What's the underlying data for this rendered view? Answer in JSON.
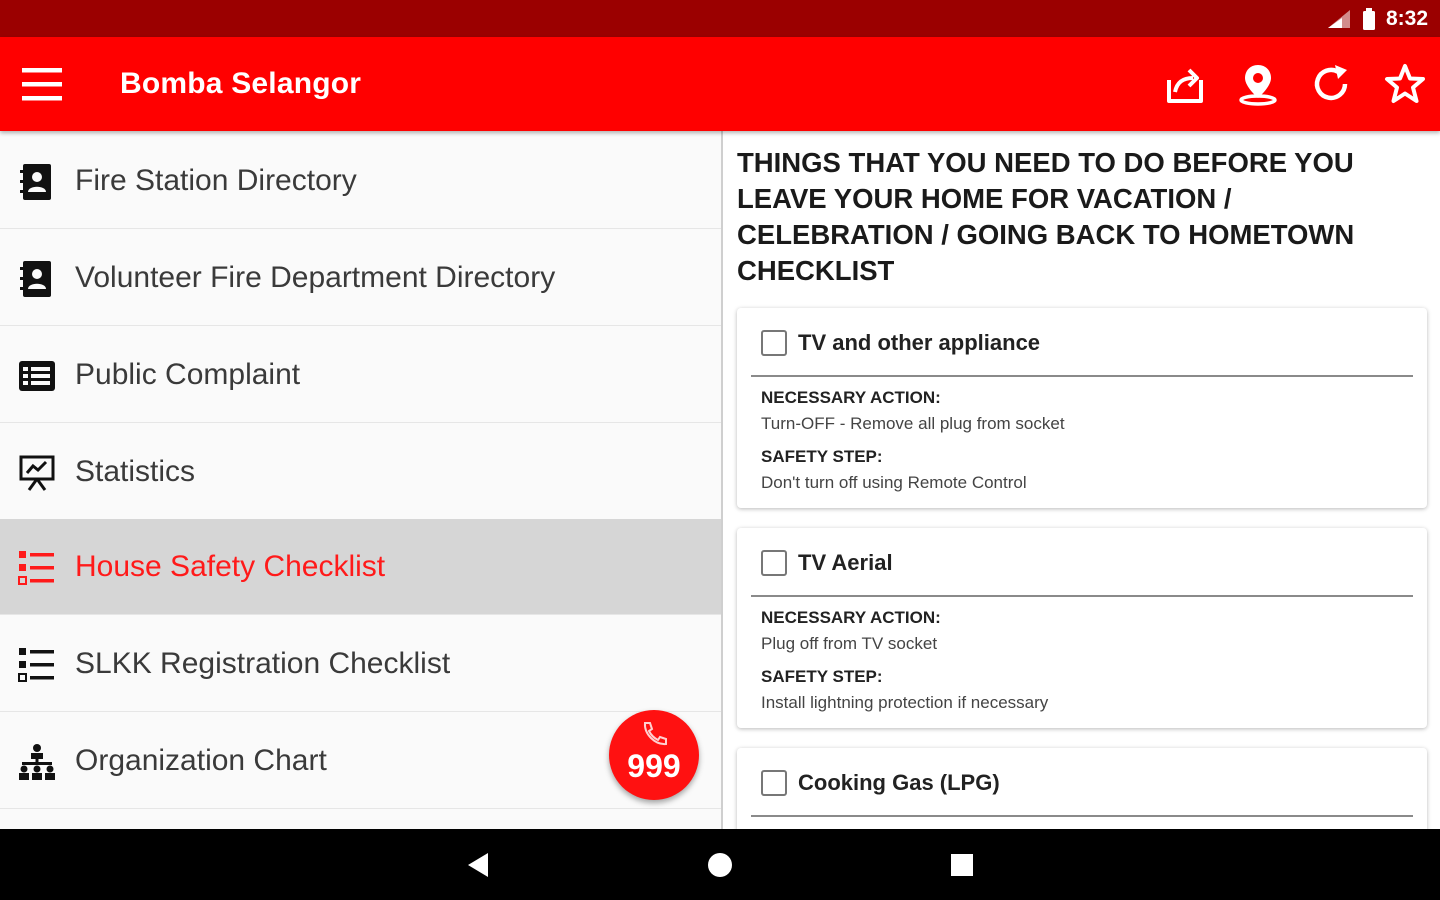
{
  "status_bar": {
    "time": "8:32",
    "icons": [
      "signal-icon",
      "battery-icon"
    ]
  },
  "app_bar": {
    "title": "Bomba Selangor",
    "background_color": "#ff0000",
    "actions": [
      "share-icon",
      "location-pin-icon",
      "refresh-icon",
      "star-icon"
    ]
  },
  "drawer": {
    "items": [
      {
        "label": "Fire Station Directory",
        "icon": "contact-book-icon",
        "active": false
      },
      {
        "label": "Volunteer Fire Department Directory",
        "icon": "contact-book-icon",
        "active": false
      },
      {
        "label": "Public Complaint",
        "icon": "complaint-form-icon",
        "active": false
      },
      {
        "label": "Statistics",
        "icon": "presentation-chart-icon",
        "active": false
      },
      {
        "label": "House Safety Checklist",
        "icon": "checklist-icon",
        "active": true
      },
      {
        "label": "SLKK Registration Checklist",
        "icon": "checklist-icon",
        "active": false
      },
      {
        "label": "Organization Chart",
        "icon": "org-chart-icon",
        "active": false
      }
    ],
    "active_color": "#ff1a1a"
  },
  "fab": {
    "label": "999",
    "icon": "phone-icon",
    "color": "#ff1111"
  },
  "checklist": {
    "heading": "THINGS THAT YOU NEED TO DO BEFORE YOU LEAVE YOUR HOME FOR VACATION / CELEBRATION / GOING BACK TO HOMETOWN CHECKLIST",
    "items": [
      {
        "title": "TV and other appliance",
        "checked": false,
        "action_label": "NECESSARY ACTION:",
        "action": "Turn-OFF - Remove all plug from socket",
        "safety_label": "SAFETY STEP:",
        "safety": "Don't turn off using Remote Control"
      },
      {
        "title": "TV Aerial",
        "checked": false,
        "action_label": "NECESSARY ACTION:",
        "action": "Plug off from TV socket",
        "safety_label": "SAFETY STEP:",
        "safety": "Install lightning protection if necessary"
      },
      {
        "title": "Cooking Gas (LPG)",
        "checked": false
      }
    ]
  },
  "nav_bar": {
    "buttons": [
      "back-icon",
      "home-icon",
      "recents-icon"
    ]
  }
}
